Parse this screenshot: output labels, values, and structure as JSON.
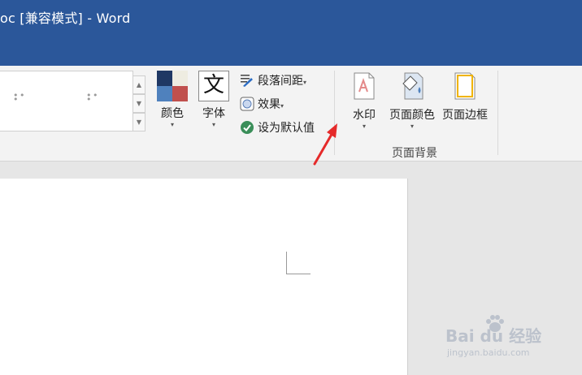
{
  "titlebar": {
    "title": "oc [兼容模式]  -  Word"
  },
  "ribbon": {
    "colors_label": "颜色",
    "fonts_label": "字体",
    "fonts_glyph": "文",
    "paragraph_spacing_label": "段落间距",
    "effects_label": "效果",
    "set_default_label": "设为默认值",
    "watermark_label": "水印",
    "page_color_label": "页面颜色",
    "page_borders_label": "页面边框",
    "group_page_background": "页面背景",
    "dropdown_caret": "▾"
  },
  "watermark": {
    "brand": "Bai du 经验",
    "url": "jingyan.baidu.com"
  },
  "colors": {
    "title_bar": "#2b579a",
    "arrow": "#e52a2a",
    "check": "#3a8e59"
  }
}
